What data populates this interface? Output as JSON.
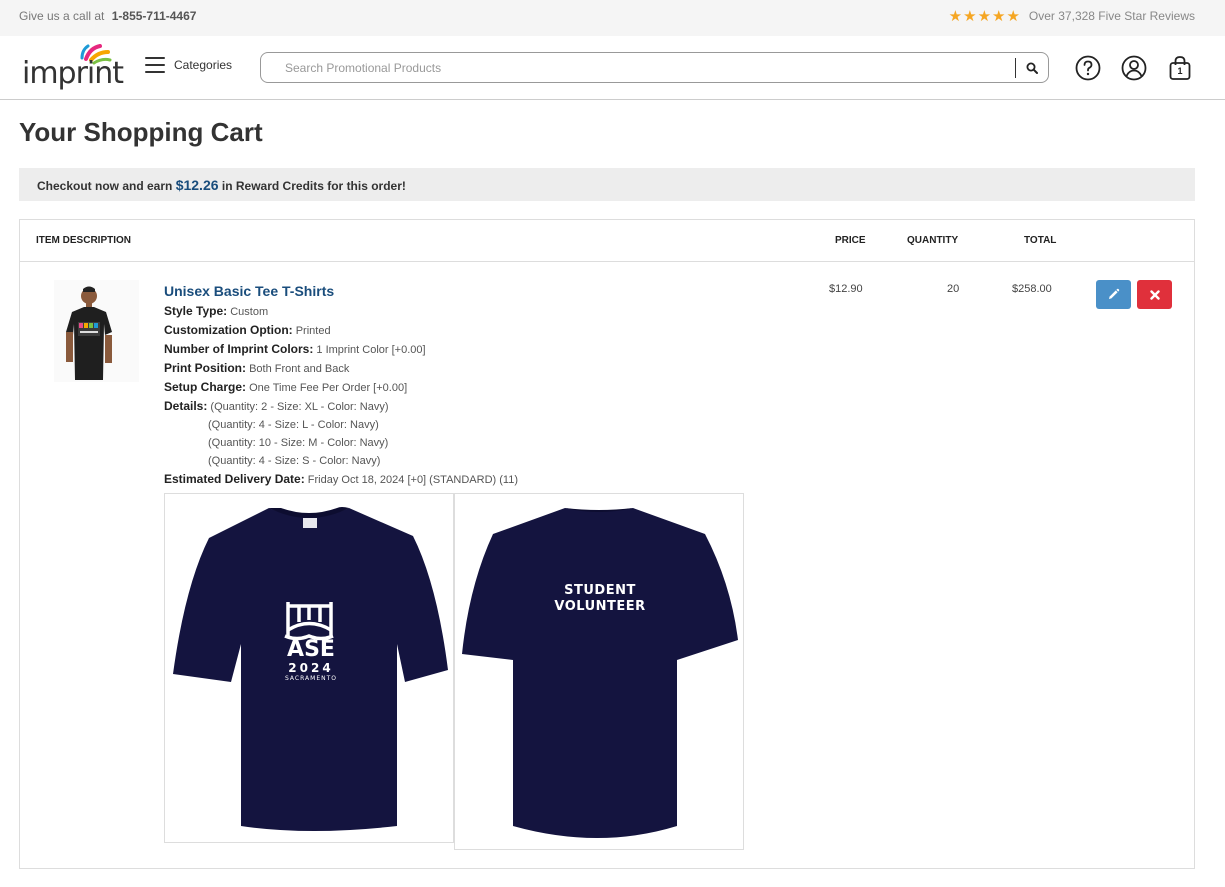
{
  "topbar": {
    "call_text": "Give us a call at",
    "phone": "1-855-711-4467",
    "stars": "★★★★★",
    "reviews_text": "Over 37,328 Five Star Reviews"
  },
  "header": {
    "logo_text": "imprint",
    "categories_label": "Categories",
    "search_placeholder": "Search Promotional Products",
    "cart_count": "1",
    "icons": [
      "hamburger-icon",
      "search-icon",
      "help-icon",
      "account-icon",
      "cart-bag-icon"
    ]
  },
  "page": {
    "title": "Your Shopping Cart",
    "reward_prefix": "Checkout now and earn",
    "reward_amount": "$12.26",
    "reward_suffix": "in Reward Credits for this order!"
  },
  "cart": {
    "columns": {
      "description": "ITEM DESCRIPTION",
      "price": "PRICE",
      "quantity": "QUANTITY",
      "total": "TOTAL"
    },
    "item": {
      "name": "Unisex Basic Tee T-Shirts",
      "style_type_label": "Style Type:",
      "style_type": "Custom",
      "customization_label": "Customization Option:",
      "customization": "Printed",
      "imprint_colors_label": "Number of Imprint Colors:",
      "imprint_colors": "1 Imprint Color [+0.00]",
      "print_position_label": "Print Position:",
      "print_position": "Both Front and Back",
      "setup_label": "Setup Charge:",
      "setup": "One Time Fee Per Order [+0.00]",
      "details_label": "Details:",
      "details": [
        "(Quantity: 2 - Size: XL - Color: Navy)",
        "(Quantity: 4 - Size: L - Color: Navy)",
        "(Quantity: 10 - Size: M - Color: Navy)",
        "(Quantity: 4 - Size: S - Color: Navy)"
      ],
      "delivery_label": "Estimated Delivery Date:",
      "delivery": "Friday Oct 18, 2024 [+0] (STANDARD) (11)",
      "price": "$12.90",
      "quantity": "20",
      "total": "$258.00",
      "front_print": {
        "line1": "ASE",
        "line2": "2024",
        "line3": "SACRAMENTO"
      },
      "back_print": {
        "line1": "STUDENT",
        "line2": "VOLUNTEER"
      }
    }
  },
  "colors": {
    "accent_blue": "#1a4d7c",
    "edit_button": "#4a90c8",
    "remove_button": "#e0303b",
    "star": "#f5a623",
    "shirt_navy": "#14143f"
  }
}
